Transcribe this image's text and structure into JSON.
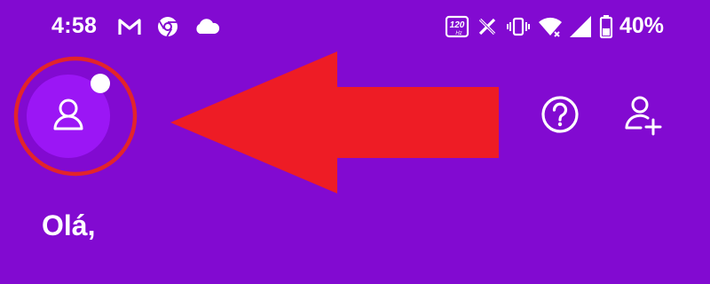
{
  "status_bar": {
    "time": "4:58",
    "refresh_rate_badge": "120",
    "refresh_rate_unit": "Hz",
    "battery_percent": "40%",
    "left_icons": [
      "gmail-icon",
      "chrome-icon",
      "cloud-icon"
    ],
    "right_icons": [
      "refresh-rate-icon",
      "x-icon",
      "vibrate-icon",
      "wifi-icon",
      "signal-icon",
      "battery-icon"
    ]
  },
  "header": {
    "avatar_icon": "user-icon",
    "notification_dot": true,
    "help_icon": "help-circle-icon",
    "add_user_icon": "add-user-icon"
  },
  "annotation": {
    "arrow_color": "#ee1c25",
    "circle_color": "#e3242b",
    "arrow_direction": "left"
  },
  "greeting": "Olá,",
  "colors": {
    "background": "#820ad1",
    "avatar_fill": "#9b16f5",
    "text": "#ffffff"
  }
}
